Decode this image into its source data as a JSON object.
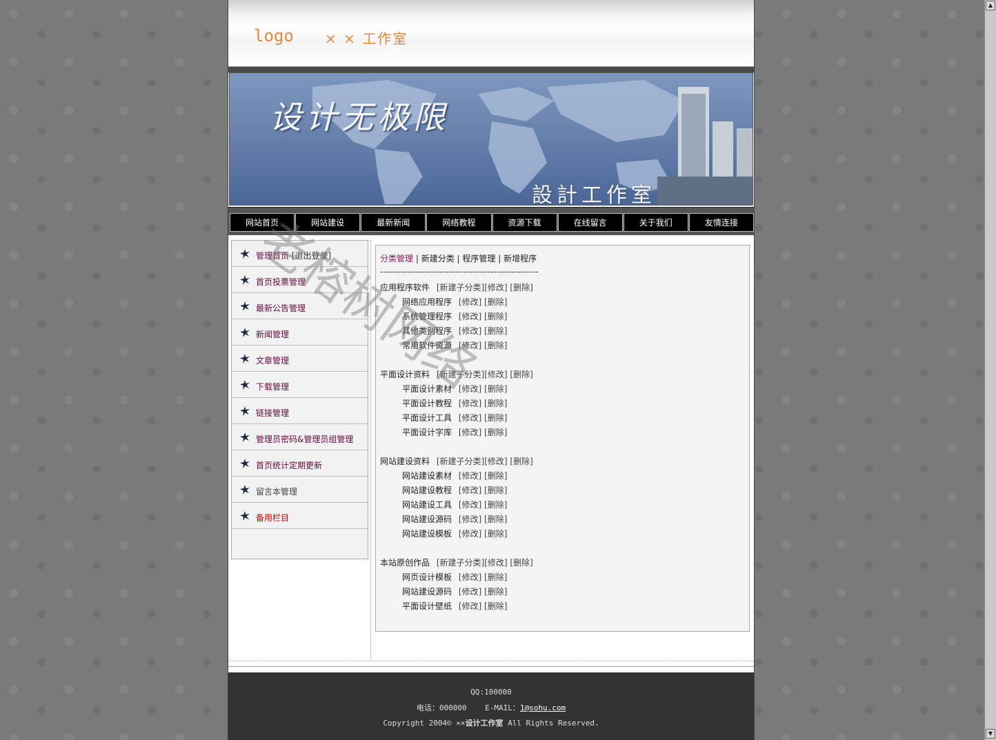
{
  "header": {
    "logo_text": "logo",
    "studio_name": "× × 工作室"
  },
  "banner": {
    "slogan": "设计无极限",
    "studio_caption": "設計工作室"
  },
  "nav": {
    "items": [
      "网站首页",
      "网站建设",
      "最新新闻",
      "网络教程",
      "资源下载",
      "在线留言",
      "关于我们",
      "友情连接"
    ]
  },
  "sidebar": {
    "items": [
      {
        "label": "管理首页",
        "suffix": "[退出登录]",
        "color": "#6a0a3a"
      },
      {
        "label": "首页投票管理",
        "color": "#6a0a3a"
      },
      {
        "label": "最新公告管理",
        "color": "#6a0a3a"
      },
      {
        "label": "新闻管理",
        "color": "#6a0a3a"
      },
      {
        "label": "文章管理",
        "color": "#6a0a3a"
      },
      {
        "label": "下载管理",
        "color": "#6a0a3a"
      },
      {
        "label": "链接管理",
        "color": "#6a0a3a"
      },
      {
        "label": "管理员密码&管理员组管理",
        "color": "#6a0a3a"
      },
      {
        "label": "首页统计定期更新",
        "color": "#6a0a3a"
      },
      {
        "label": "留言本管理",
        "color": "#444444"
      },
      {
        "label": "备用栏目",
        "color": "#cc0000"
      }
    ]
  },
  "content": {
    "tabs": [
      "分类管理",
      "新建分类",
      "程序管理",
      "新增程序"
    ],
    "active_tab_color": "#8a1a5a",
    "dashes": "-----------------------------------------------------",
    "actions": {
      "new_sub": "[新建子分类]",
      "edit": "[修改]",
      "delete": "[删除]"
    },
    "categories": [
      {
        "name": "应用程序软件",
        "subs": [
          "网络应用程序",
          "系统管理程序",
          "其他类别程序",
          "常用软件资源"
        ]
      },
      {
        "name": "平面设计资料",
        "subs": [
          "平面设计素材",
          "平面设计教程",
          "平面设计工具",
          "平面设计字库"
        ]
      },
      {
        "name": "网站建设资料",
        "subs": [
          "网站建设素材",
          "网站建设教程",
          "网站建设工具",
          "网站建设源码",
          "网站建设模板"
        ]
      },
      {
        "name": "本站原创作品",
        "subs": [
          "网页设计模板",
          "网站建设源码",
          "平面设计壁纸"
        ]
      }
    ]
  },
  "footer": {
    "qq": "QQ:100000",
    "phone_label": "电话：000000",
    "email_label": "E-MAIL：",
    "email": "1@sohu.com",
    "copyright_prefix": "Copyright 2004© ××",
    "copyright_bold": "设计工作室",
    "copyright_suffix": "All Rights Reserved."
  },
  "watermark": "老榕树网络"
}
